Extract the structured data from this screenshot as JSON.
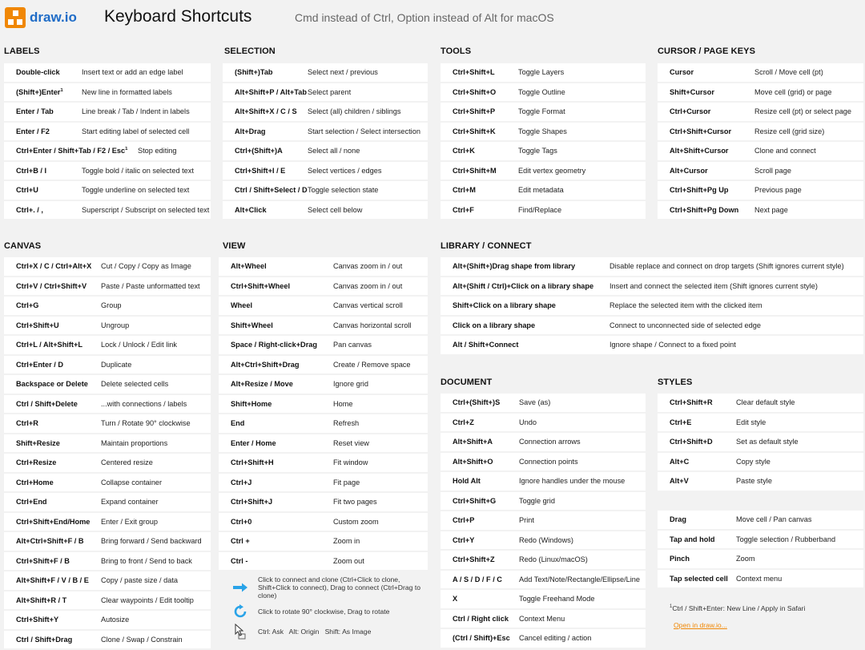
{
  "header": {
    "logo_text": "draw.io",
    "title": "Keyboard Shortcuts",
    "subtitle": "Cmd instead of Ctrl, Option instead of Alt for macOS"
  },
  "sections": [
    {
      "id": "labels",
      "title": "LABELS",
      "rows": [
        {
          "k": "Double-click",
          "d": "Insert text or add an edge label"
        },
        {
          "k": "(Shift+)Enter",
          "sup": "1",
          "d": "New line in formatted labels"
        },
        {
          "k": "Enter / Tab",
          "d": "Line break / Tab / Indent in labels"
        },
        {
          "k": "Enter / F2",
          "d": "Start editing label of selected cell"
        },
        {
          "k": "Ctrl+Enter / Shift+Tab / F2 / Esc",
          "sup": "1",
          "d": "Stop editing"
        },
        {
          "k": "Ctrl+B / I",
          "d": "Toggle bold / italic on selected text"
        },
        {
          "k": "Ctrl+U",
          "d": "Toggle underline on selected text"
        },
        {
          "k": "Ctrl+. / ,",
          "d": "Superscript / Subscript on selected text"
        }
      ]
    },
    {
      "id": "selection",
      "title": "SELECTION",
      "rows": [
        {
          "k": "(Shift+)Tab",
          "d": "Select next / previous"
        },
        {
          "k": "Alt+Shift+P / Alt+Tab",
          "d": "Select parent"
        },
        {
          "k": "Alt+Shift+X / C / S",
          "d": "Select (all) children / siblings"
        },
        {
          "k": "Alt+Drag",
          "d": "Start selection / Select intersection"
        },
        {
          "k": "Ctrl+(Shift+)A",
          "d": "Select all / none"
        },
        {
          "k": "Ctrl+Shift+I / E",
          "d": "Select vertices / edges"
        },
        {
          "k": "Ctrl / Shift+Select / Drag",
          "d": "Toggle selection state"
        },
        {
          "k": "Alt+Click",
          "d": "Select cell below"
        }
      ]
    },
    {
      "id": "tools",
      "title": "TOOLS",
      "rows": [
        {
          "k": "Ctrl+Shift+L",
          "d": "Toggle Layers"
        },
        {
          "k": "Ctrl+Shift+O",
          "d": "Toggle Outline"
        },
        {
          "k": "Ctrl+Shift+P",
          "d": "Toggle Format"
        },
        {
          "k": "Ctrl+Shift+K",
          "d": "Toggle Shapes"
        },
        {
          "k": "Ctrl+K",
          "d": "Toggle Tags"
        },
        {
          "k": "Ctrl+Shift+M",
          "d": "Edit vertex geometry"
        },
        {
          "k": "Ctrl+M",
          "d": "Edit metadata"
        },
        {
          "k": "Ctrl+F",
          "d": "Find/Replace"
        }
      ]
    },
    {
      "id": "cursor",
      "title": "CURSOR / PAGE KEYS",
      "rows": [
        {
          "k": "Cursor",
          "d": "Scroll / Move cell (pt)"
        },
        {
          "k": "Shift+Cursor",
          "d": "Move cell (grid) or page"
        },
        {
          "k": "Ctrl+Cursor",
          "d": "Resize cell (pt) or select page"
        },
        {
          "k": "Ctrl+Shift+Cursor",
          "d": "Resize cell (grid size)"
        },
        {
          "k": "Alt+Shift+Cursor",
          "d": "Clone and connect"
        },
        {
          "k": "Alt+Cursor",
          "d": "Scroll page"
        },
        {
          "k": "Ctrl+Shift+Pg Up",
          "d": "Previous page"
        },
        {
          "k": "Ctrl+Shift+Pg Down",
          "d": "Next page"
        }
      ]
    },
    {
      "id": "canvas",
      "title": "CANVAS",
      "rows": [
        {
          "k": "Ctrl+X / C / Ctrl+Alt+X",
          "d": "Cut / Copy / Copy as Image"
        },
        {
          "k": "Ctrl+V / Ctrl+Shift+V",
          "d": "Paste / Paste unformatted text"
        },
        {
          "k": "Ctrl+G",
          "d": "Group"
        },
        {
          "k": "Ctrl+Shift+U",
          "d": "Ungroup"
        },
        {
          "k": "Ctrl+L / Alt+Shift+L",
          "d": "Lock / Unlock / Edit link"
        },
        {
          "k": "Ctrl+Enter / D",
          "d": "Duplicate"
        },
        {
          "k": "Backspace or Delete",
          "d": "Delete selected cells"
        },
        {
          "k": "Ctrl / Shift+Delete",
          "d": "...with connections / labels"
        },
        {
          "k": "Ctrl+R",
          "d": "Turn / Rotate 90° clockwise"
        },
        {
          "k": "Shift+Resize",
          "d": "Maintain proportions"
        },
        {
          "k": "Ctrl+Resize",
          "d": "Centered resize"
        },
        {
          "k": "Ctrl+Home",
          "d": "Collapse container"
        },
        {
          "k": "Ctrl+End",
          "d": "Expand container"
        },
        {
          "k": "Ctrl+Shift+End/Home",
          "d": "Enter / Exit group"
        },
        {
          "k": "Alt+Ctrl+Shift+F / B",
          "d": "Bring forward / Send backward"
        },
        {
          "k": "Ctrl+Shift+F / B",
          "d": "Bring to front / Send to back"
        },
        {
          "k": "Alt+Shift+F / V / B / E",
          "d": "Copy / paste size / data"
        },
        {
          "k": "Alt+Shift+R / T",
          "d": "Clear waypoints / Edit tooltip"
        },
        {
          "k": "Ctrl+Shift+Y",
          "d": "Autosize"
        },
        {
          "k": "Ctrl / Shift+Drag",
          "d": "Clone / Swap / Constrain"
        }
      ]
    },
    {
      "id": "view",
      "title": "VIEW",
      "rows": [
        {
          "k": "Alt+Wheel",
          "d": "Canvas zoom in / out"
        },
        {
          "k": "Ctrl+Shift+Wheel",
          "d": "Canvas zoom in / out"
        },
        {
          "k": "Wheel",
          "d": "Canvas vertical scroll"
        },
        {
          "k": "Shift+Wheel",
          "d": "Canvas horizontal scroll"
        },
        {
          "k": "Space / Right-click+Drag",
          "d": "Pan canvas"
        },
        {
          "k": "Alt+Ctrl+Shift+Drag",
          "d": "Create / Remove space"
        },
        {
          "k": "Alt+Resize / Move",
          "d": "Ignore grid"
        },
        {
          "k": "Shift+Home",
          "d": "Home"
        },
        {
          "k": "End",
          "d": "Refresh"
        },
        {
          "k": "Enter / Home",
          "d": "Reset view"
        },
        {
          "k": "Ctrl+Shift+H",
          "d": "Fit window"
        },
        {
          "k": "Ctrl+J",
          "d": "Fit page"
        },
        {
          "k": "Ctrl+Shift+J",
          "d": "Fit two pages"
        },
        {
          "k": "Ctrl+0",
          "d": "Custom zoom"
        },
        {
          "k": "Ctrl +",
          "d": "Zoom in"
        },
        {
          "k": "Ctrl -",
          "d": "Zoom out"
        }
      ]
    },
    {
      "id": "library",
      "title": "LIBRARY / CONNECT",
      "rows": [
        {
          "k": "Alt+(Shift+)Drag shape from library",
          "d": "Disable replace and connect on drop targets (Shift ignores current style)"
        },
        {
          "k": "Alt+(Shift / Ctrl)+Click on a library shape",
          "d": "Insert and connect the selected item (Shift ignores current style)"
        },
        {
          "k": "Shift+Click on a library shape",
          "d": "Replace the selected item with the clicked item"
        },
        {
          "k": "Click on a library shape",
          "d": "Connect to unconnected side of selected edge"
        },
        {
          "k": "Alt / Shift+Connect",
          "d": "Ignore shape / Connect to a fixed point"
        }
      ]
    },
    {
      "id": "document",
      "title": "DOCUMENT",
      "rows": [
        {
          "k": "Ctrl+(Shift+)S",
          "d": "Save (as)"
        },
        {
          "k": "Ctrl+Z",
          "d": "Undo"
        },
        {
          "k": "Alt+Shift+A",
          "d": "Connection arrows"
        },
        {
          "k": "Alt+Shift+O",
          "d": "Connection points"
        },
        {
          "k": "Hold Alt",
          "d": "Ignore handles under the mouse"
        },
        {
          "k": "Ctrl+Shift+G",
          "d": "Toggle grid"
        },
        {
          "k": "Ctrl+P",
          "d": "Print"
        },
        {
          "k": "Ctrl+Y",
          "d": "Redo (Windows)"
        },
        {
          "k": "Ctrl+Shift+Z",
          "d": "Redo (Linux/macOS)"
        },
        {
          "k": "A / S / D / F / C",
          "d": "Add Text/Note/Rectangle/Ellipse/Line"
        },
        {
          "k": "X",
          "d": "Toggle Freehand Mode"
        },
        {
          "k": "Ctrl / Right click",
          "d": "Context Menu"
        },
        {
          "k": "(Ctrl / Shift)+Esc",
          "d": "Cancel editing / action"
        }
      ]
    },
    {
      "id": "styles",
      "title": "STYLES",
      "rows": [
        {
          "k": "Ctrl+Shift+R",
          "d": "Clear default style"
        },
        {
          "k": "Ctrl+E",
          "d": "Edit style"
        },
        {
          "k": "Ctrl+Shift+D",
          "d": "Set as default style"
        },
        {
          "k": "Alt+C",
          "d": "Copy style"
        },
        {
          "k": "Alt+V",
          "d": "Paste style"
        }
      ]
    },
    {
      "id": "touch",
      "title": "",
      "rows": [
        {
          "k": "Drag",
          "d": "Move cell / Pan canvas"
        },
        {
          "k": "Tap and hold",
          "d": "Toggle selection / Rubberband"
        },
        {
          "k": "Pinch",
          "d": "Zoom"
        },
        {
          "k": "Tap selected cell",
          "d": "Context menu"
        }
      ]
    }
  ],
  "notes": [
    {
      "icon": "blue-arrow-icon",
      "text": "Click to connect and clone (Ctrl+Click to clone, Shift+Click to connect), Drag to connect (Ctrl+Drag to clone)"
    },
    {
      "icon": "rotate-icon",
      "text": "Click to rotate 90° clockwise, Drag to rotate"
    },
    {
      "icon": "cursor-icon",
      "text": "Ctrl: Ask   Alt: Origin   Shift: As Image"
    }
  ],
  "footnote": {
    "sup": "1",
    "text": "Ctrl / Shift+Enter: New Line / Apply in Safari"
  },
  "open_link": "Open in draw.io...",
  "colors": {
    "accent": "#f08705",
    "brand_blue": "#1f6cc7",
    "row_bg": "#ffffff",
    "page_bg": "#f2f2f2",
    "icon_blue": "#29a3e8"
  }
}
